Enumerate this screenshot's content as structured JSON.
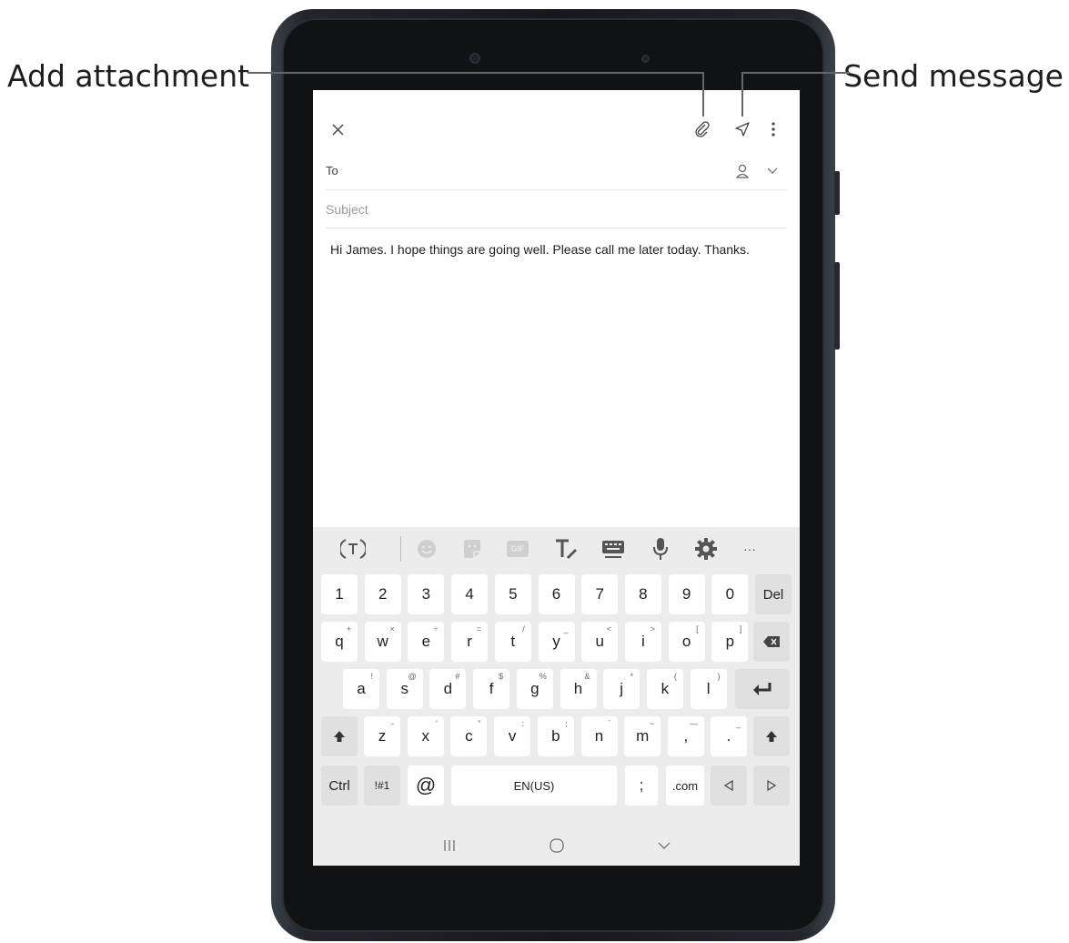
{
  "callouts": {
    "left": "Add attachment",
    "right": "Send message"
  },
  "compose": {
    "to_label": "To",
    "subject_placeholder": "Subject",
    "body": "Hi James. I hope things are going well. Please call me later today. Thanks."
  },
  "icons": {
    "close": "close-icon",
    "attach": "paperclip-icon",
    "send": "send-icon",
    "more": "more-vertical-icon",
    "contact": "person-icon",
    "expand": "chevron-down-icon"
  },
  "keyboard": {
    "toolbar": [
      "translate-icon",
      "emoji-icon",
      "sticker-icon",
      "gif-icon",
      "handwriting-icon",
      "keyboard-icon",
      "microphone-icon",
      "settings-icon",
      "more-horizontal-icon"
    ],
    "toolbar_more": "···",
    "gif_label": "GIF",
    "row1": [
      "1",
      "2",
      "3",
      "4",
      "5",
      "6",
      "7",
      "8",
      "9",
      "0",
      "Del"
    ],
    "row2": [
      "q",
      "w",
      "e",
      "r",
      "t",
      "y",
      "u",
      "i",
      "o",
      "p"
    ],
    "row2_sub": [
      "+",
      "×",
      "÷",
      "=",
      "/",
      "_",
      "<",
      ">",
      "[",
      "]"
    ],
    "row3": [
      "a",
      "s",
      "d",
      "f",
      "g",
      "h",
      "j",
      "k",
      "l"
    ],
    "row3_sub": [
      "!",
      "@",
      "#",
      "$",
      "%",
      "&",
      "*",
      "(",
      ")"
    ],
    "row4": [
      "z",
      "x",
      "c",
      "v",
      "b",
      "n",
      "m",
      ",",
      ".",
      "."
    ],
    "row4_sub": [
      "-",
      "'",
      "\"",
      ":",
      ";",
      "`",
      "~",
      "—",
      "_"
    ],
    "ctrl": "Ctrl",
    "symbols": "!#1",
    "at": "@",
    "space": "EN(US)",
    "semicolon": ";",
    "dotcom": ".com",
    "comma_sub": "—",
    "period_sub": "_"
  },
  "colors": {
    "keyboard_bg": "#ececec",
    "key_bg": "#ffffff",
    "fn_key_bg": "#e0e0e0"
  }
}
